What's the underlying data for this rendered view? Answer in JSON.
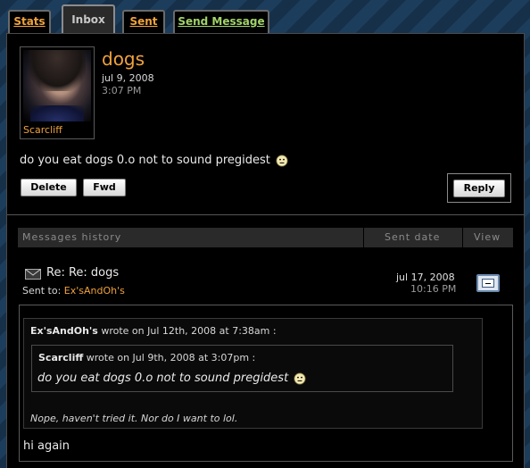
{
  "tabs": [
    {
      "label": "Stats"
    },
    {
      "label": "Inbox"
    },
    {
      "label": "Sent"
    },
    {
      "label": "Send Message"
    }
  ],
  "message": {
    "sender": "Scarcliff",
    "subject": "dogs",
    "date": "jul 9, 2008",
    "time": "3:07 PM",
    "body": "do you eat dogs 0.o not to sound pregidest"
  },
  "actions": {
    "delete": "Delete",
    "fwd": "Fwd",
    "reply": "Reply"
  },
  "history": {
    "columns": {
      "title": "Messages history",
      "date": "Sent date",
      "view": "View"
    },
    "item": {
      "subject": "Re: Re: dogs",
      "sent_to_label": "Sent to:",
      "sent_to": "Ex'sAndOh's",
      "date": "jul 17, 2008",
      "time": "10:16 PM"
    },
    "thread": {
      "outer_author": "Ex'sAndOh's",
      "outer_meta": "wrote on Jul 12th, 2008 at 7:38am :",
      "inner_author": "Scarcliff",
      "inner_meta": "wrote on Jul 9th, 2008 at 3:07pm :",
      "inner_text": "do you eat dogs 0.o not to sound pregidest",
      "outer_text": "Nope, haven't tried it. Nor do I want to lol.",
      "reply": "hi again"
    }
  },
  "colors": {
    "accent": "#f0a23c",
    "accent_green": "#a2d36a",
    "bg": "#000000"
  }
}
